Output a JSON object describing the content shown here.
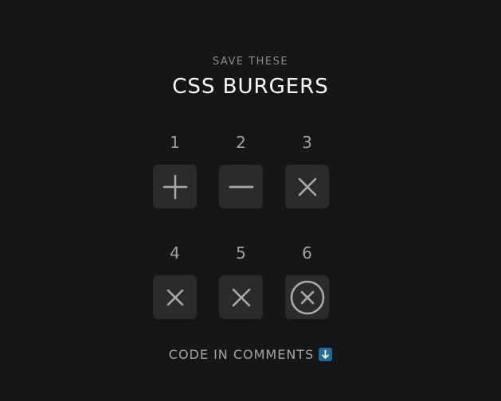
{
  "header": {
    "eyebrow": "SAVE THESE",
    "title": "CSS BURGERS"
  },
  "burgers": [
    {
      "number": "1",
      "icon": "plus-icon"
    },
    {
      "number": "2",
      "icon": "minus-icon"
    },
    {
      "number": "3",
      "icon": "close-icon"
    },
    {
      "number": "4",
      "icon": "close-icon"
    },
    {
      "number": "5",
      "icon": "close-icon"
    },
    {
      "number": "6",
      "icon": "close-circle-icon"
    }
  ],
  "footer": {
    "text": "CODE IN COMMENTS",
    "icon": "down-arrow-icon"
  },
  "colors": {
    "background": "#161618",
    "button": "#2b2b2e",
    "icon": "#a9a9ab",
    "arrow_badge": "#1f6b9a"
  }
}
